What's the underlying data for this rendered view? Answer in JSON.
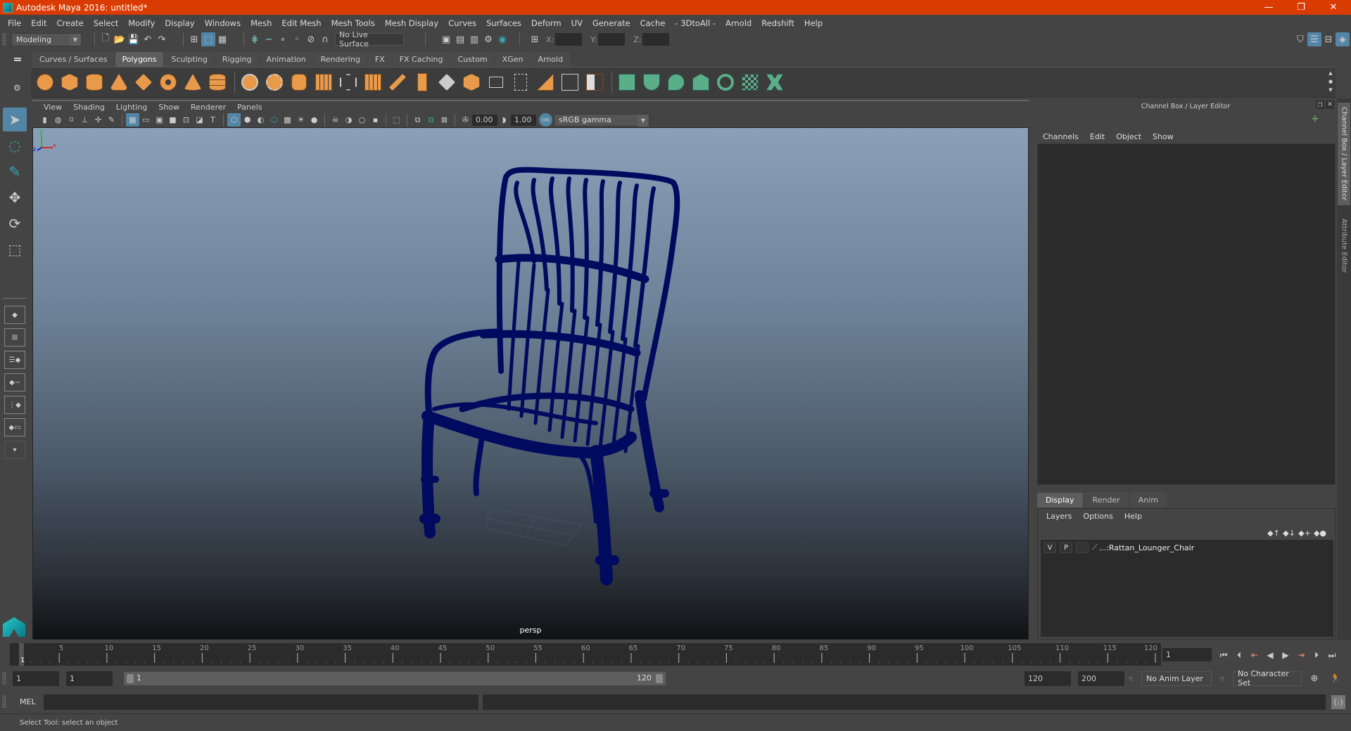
{
  "window": {
    "title": "Autodesk Maya 2016: untitled*",
    "controls": {
      "minimize": "—",
      "restore": "❐",
      "close": "✕"
    }
  },
  "menubar": [
    "File",
    "Edit",
    "Create",
    "Select",
    "Modify",
    "Display",
    "Windows",
    "Mesh",
    "Edit Mesh",
    "Mesh Tools",
    "Mesh Display",
    "Curves",
    "Surfaces",
    "Deform",
    "UV",
    "Generate",
    "Cache",
    "- 3DtoAll -",
    "Arnold",
    "Redshift",
    "Help"
  ],
  "statusline": {
    "menuset": "Modeling",
    "live_surface": "No Live Surface",
    "x_label": "X:",
    "y_label": "Y:",
    "z_label": "Z:",
    "x_value": "",
    "y_value": "",
    "z_value": ""
  },
  "shelf": {
    "tabs": [
      "Curves / Surfaces",
      "Polygons",
      "Sculpting",
      "Rigging",
      "Animation",
      "Rendering",
      "FX",
      "FX Caching",
      "Custom",
      "XGen",
      "Arnold"
    ],
    "active_tab": "Polygons",
    "icons_orange": [
      "poly-sphere-icon",
      "poly-cube-icon",
      "poly-cylinder-icon",
      "poly-cone-icon",
      "poly-plane-icon",
      "poly-torus-icon",
      "poly-pyramid-icon",
      "poly-pipe-icon"
    ],
    "icons_modeling": [
      "combine-icon",
      "separate-icon",
      "mirror-icon",
      "smooth-icon",
      "bevel-icon",
      "subdivide-icon",
      "multicut-icon",
      "extrude-icon",
      "bridge-icon",
      "bevel-face-icon",
      "append-icon",
      "insert-edge-loop-icon",
      "merge-icon",
      "target-weld-icon",
      "fill-hole-icon"
    ],
    "icons_uv": [
      "planar-uv-icon",
      "cylindrical-uv-icon",
      "spherical-uv-icon",
      "automatic-uv-icon",
      "unfold-uv-icon",
      "uv-editor-icon",
      "cut-sew-uv-icon"
    ]
  },
  "panel": {
    "menus": [
      "View",
      "Shading",
      "Lighting",
      "Show",
      "Renderer",
      "Panels"
    ],
    "exposure": "0.00",
    "gamma": "1.00",
    "color_mgmt_badge": "ON",
    "color_space": "sRGB gamma",
    "camera_label": "persp",
    "axis": {
      "x": "x",
      "y": "y",
      "z": "z"
    }
  },
  "channel_box": {
    "title": "Channel Box / Layer Editor",
    "menus": [
      "Channels",
      "Edit",
      "Object",
      "Show"
    ]
  },
  "layer_editor": {
    "tabs": [
      "Display",
      "Render",
      "Anim"
    ],
    "active_tab": "Display",
    "menus": [
      "Layers",
      "Options",
      "Help"
    ],
    "layers": [
      {
        "visible": "V",
        "playback": "P",
        "name": "...:Rattan_Lounger_Chair"
      }
    ]
  },
  "side_tabs": [
    "Channel Box / Layer Editor",
    "Attribute Editor"
  ],
  "timeline": {
    "ticks": [
      1,
      5,
      10,
      15,
      20,
      25,
      30,
      35,
      40,
      45,
      50,
      55,
      60,
      65,
      70,
      75,
      80,
      85,
      90,
      95,
      100,
      105,
      110,
      115,
      120
    ],
    "current_frame": "1",
    "range_min": 1,
    "range_max": 120
  },
  "range": {
    "start": "1",
    "playback_start": "1",
    "slider_start": "1",
    "slider_end": "120",
    "playback_end": "120",
    "end": "200",
    "anim_layer": "No Anim Layer",
    "character_set": "No Character Set"
  },
  "mel": {
    "label": "MEL",
    "input": "",
    "output": ""
  },
  "help_line": "Select Tool: select an object",
  "colors": {
    "titlebar": "#d93b00",
    "accent": "#5285a6",
    "wireframe": "#000a5e",
    "shelf_orange": "#e89a4a",
    "shelf_green": "#5aae8a"
  }
}
